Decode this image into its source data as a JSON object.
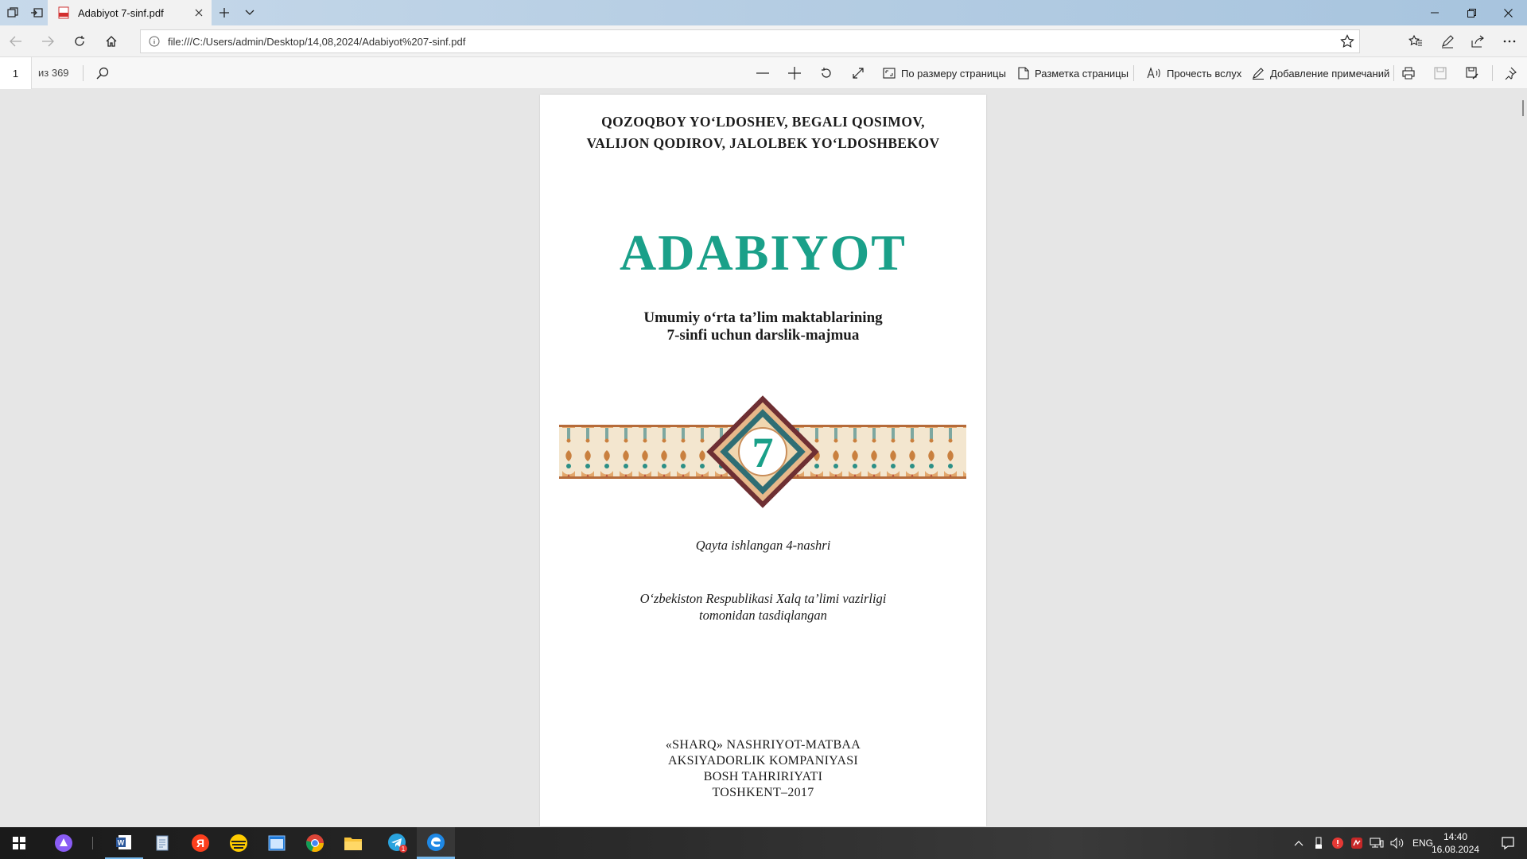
{
  "tab": {
    "title": "Adabiyot 7-sinf.pdf"
  },
  "address": {
    "url": "file:///C:/Users/admin/Desktop/14,08,2024/Adabiyot%207-sinf.pdf"
  },
  "pdf_toolbar": {
    "page_number": "1",
    "page_count": "из 369",
    "fit_page_label": "По размеру страницы",
    "page_layout_label": "Разметка страницы",
    "read_aloud_label": "Прочесть вслух",
    "add_notes_label": "Добавление примечаний"
  },
  "document": {
    "authors_line1": "QOZOQBOY YO‘LDOSHEV, BEGALI QOSIMOV,",
    "authors_line2": "VALIJON QODIROV, JALOLBEK YO‘LDOSHBEKOV",
    "title": "ADABIYOT",
    "subtitle_line1": "Umumiy o‘rta ta’lim maktablarining",
    "subtitle_line2": "7-sinfi uchun darslik-majmua",
    "grade": "7",
    "edition": "Qayta ishlangan 4-nashri",
    "approval_line1": "O‘zbekiston Respublikasi Xalq ta’limi vazirligi",
    "approval_line2": "tomonidan tasdiqlangan",
    "publisher_line1": "«SHARQ» NASHRIYOT-MATBAA",
    "publisher_line2": "AKSIYADORLIK KOMPANIYASI",
    "publisher_line3": "BOSH TAHRIRIYATI",
    "publisher_line4": "TOSHKENT–2017"
  },
  "taskbar": {
    "language": "ENG",
    "time": "14:40",
    "date": "16.08.2024",
    "telegram_badge": "1"
  },
  "colors": {
    "title_teal": "#1aa089",
    "tabstrip": "#b5cde3",
    "taskbar": "#2a2a2a"
  }
}
